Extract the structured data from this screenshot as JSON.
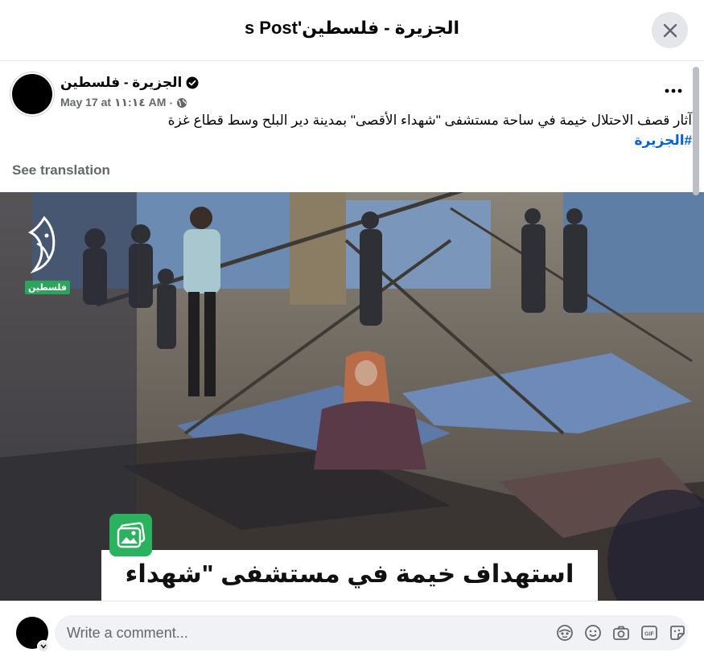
{
  "dialog": {
    "title": "الجزيرة - فلسطين's Post"
  },
  "post": {
    "page_name": "الجزيرة - فلسطين",
    "date": "May 17 at ١١:١٤ AM",
    "separator": "·",
    "text": "آثار قصف الاحتلال خيمة في ساحة مستشفى \"شهداء الأقصى\" بمدينة دير البلح وسط قطاع غزة",
    "hashtag": "#الجزيرة",
    "see_translation": "See translation"
  },
  "photo": {
    "logo_tag": "فلسطين",
    "caption": "استهداف خيمة في مستشفى \"شهداء الأقصى\""
  },
  "comment": {
    "placeholder": "Write a comment..."
  },
  "icons": {
    "close": "close-icon",
    "more": "more-icon",
    "verified": "verified-badge-icon",
    "audience": "globe-icon",
    "avatar_badge": "chevron-down-icon",
    "comment_tools": [
      "avatar-sticker-icon",
      "emoji-icon",
      "camera-icon",
      "gif-icon",
      "sticker-icon"
    ]
  },
  "colors": {
    "link_blue": "#0064d1",
    "secondary_text": "#65676b",
    "brand_green": "#2ab25e"
  }
}
